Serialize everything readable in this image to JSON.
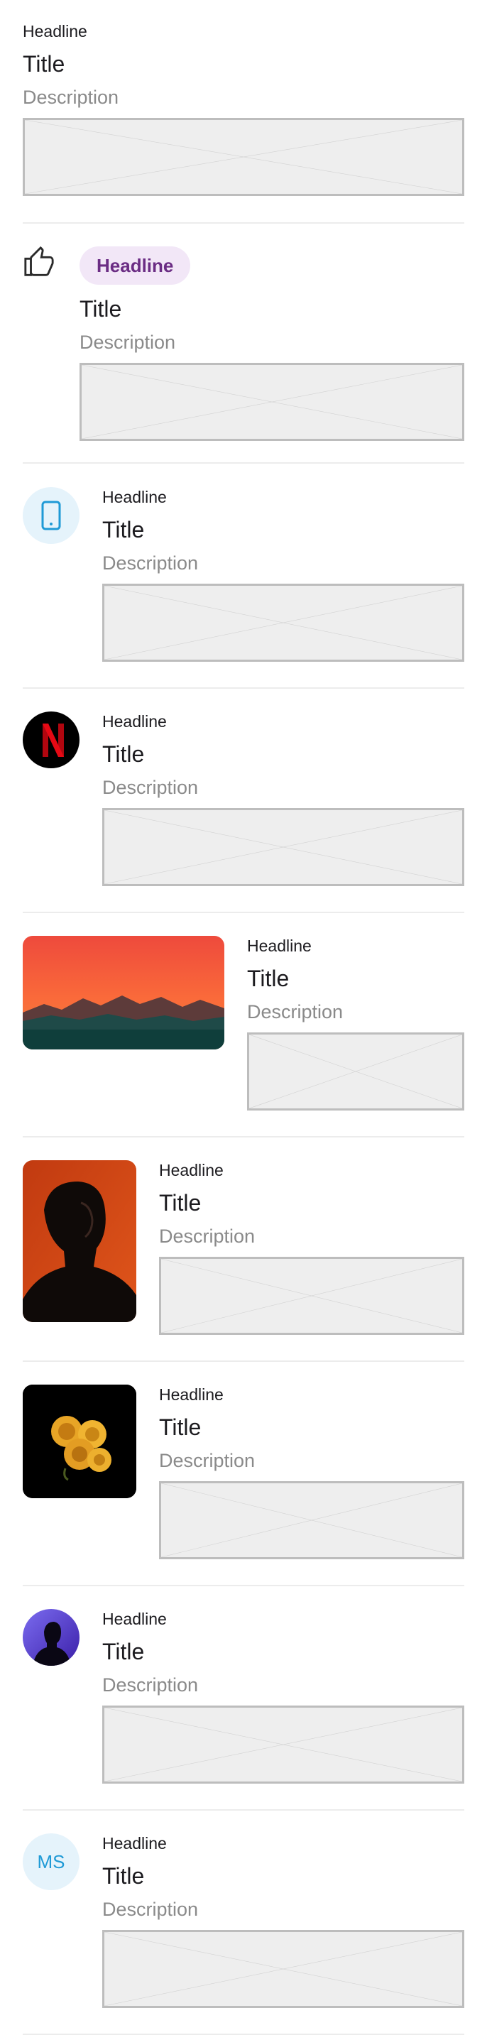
{
  "items": [
    {
      "type": "text",
      "headline": "Headline",
      "title": "Title",
      "description": "Description"
    },
    {
      "type": "icon-chip",
      "icon": "thumb-up-icon",
      "headline": "Headline",
      "title": "Title",
      "description": "Description"
    },
    {
      "type": "icon-circle",
      "icon": "smartphone-icon",
      "headline": "Headline",
      "title": "Title",
      "description": "Description"
    },
    {
      "type": "logo",
      "logo": "netflix-logo",
      "headline": "Headline",
      "title": "Title",
      "description": "Description"
    },
    {
      "type": "landscape-image",
      "image": "sunset-mountains-image",
      "headline": "Headline",
      "title": "Title",
      "description": "Description"
    },
    {
      "type": "portrait-image",
      "image": "portrait-man-image",
      "headline": "Headline",
      "title": "Title",
      "description": "Description"
    },
    {
      "type": "square-image",
      "image": "yellow-roses-image",
      "headline": "Headline",
      "title": "Title",
      "description": "Description"
    },
    {
      "type": "avatar",
      "image": "silhouette-avatar",
      "headline": "Headline",
      "title": "Title",
      "description": "Description"
    },
    {
      "type": "initials-avatar",
      "initials": "MS",
      "headline": "Headline",
      "title": "Title",
      "description": "Description"
    }
  ],
  "colors": {
    "accent_blue": "#1f9ad6",
    "chip_bg": "#f2e7f7",
    "chip_text": "#6b2d84",
    "divider": "#ececec",
    "placeholder_bg": "#eeeeee"
  }
}
